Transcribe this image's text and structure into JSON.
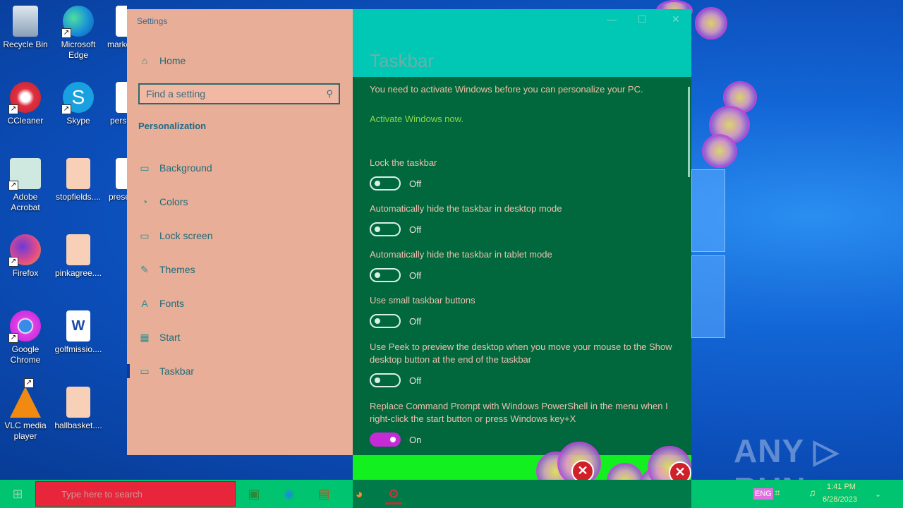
{
  "desktop": {
    "icons": [
      {
        "label": "Recycle Bin"
      },
      {
        "label": "Microsoft Edge"
      },
      {
        "label": "marke"
      },
      {
        "label": "CCleaner"
      },
      {
        "label": "Skype"
      },
      {
        "label": "perso"
      },
      {
        "label": "Adobe Acrobat"
      },
      {
        "label": "stopfields...."
      },
      {
        "label": "prese"
      },
      {
        "label": "Firefox"
      },
      {
        "label": "pinkagree...."
      },
      {
        "label": "Google Chrome"
      },
      {
        "label": "golfmissio...."
      },
      {
        "label": "VLC media player"
      },
      {
        "label": "hallbasket...."
      }
    ],
    "watermark": "ANY ▷ RUN"
  },
  "settings": {
    "app_title": "Settings",
    "home_label": "Home",
    "search_placeholder": "Find a setting",
    "category": "Personalization",
    "nav": [
      {
        "label": "Background",
        "icon": "image-icon"
      },
      {
        "label": "Colors",
        "icon": "palette-icon"
      },
      {
        "label": "Lock screen",
        "icon": "lock-screen-icon"
      },
      {
        "label": "Themes",
        "icon": "themes-icon"
      },
      {
        "label": "Fonts",
        "icon": "fonts-icon"
      },
      {
        "label": "Start",
        "icon": "start-icon"
      },
      {
        "label": "Taskbar",
        "icon": "taskbar-icon",
        "active": true
      }
    ],
    "page_title": "Taskbar",
    "activation_message": "You need to activate Windows before you can personalize your PC.",
    "activate_link": "Activate Windows now.",
    "options": [
      {
        "label": "Lock the taskbar",
        "state": "Off",
        "on": false
      },
      {
        "label": "Automatically hide the taskbar in desktop mode",
        "state": "Off",
        "on": false
      },
      {
        "label": "Automatically hide the taskbar in tablet mode",
        "state": "Off",
        "on": false
      },
      {
        "label": "Use small taskbar buttons",
        "state": "Off",
        "on": false
      },
      {
        "label": "Use Peek to preview the desktop when you move your mouse to the Show desktop button at the end of the taskbar",
        "state": "Off",
        "on": false
      },
      {
        "label": "Replace Command Prompt with Windows PowerShell in the menu when I right-click the start button or press Windows key+X",
        "state": "On",
        "on": true
      }
    ]
  },
  "taskbar": {
    "search_text": "Type here to search",
    "tray_lang": "ENG",
    "clock_time": "1:41 PM",
    "clock_date": "6/28/2023"
  },
  "colors": {
    "sidebar_bg": "#e8ae97",
    "content_bg": "#00683c",
    "header_bg": "#00c8b4",
    "toggle_on": "#c62bd6",
    "taskbar_bg": "#00c470"
  }
}
